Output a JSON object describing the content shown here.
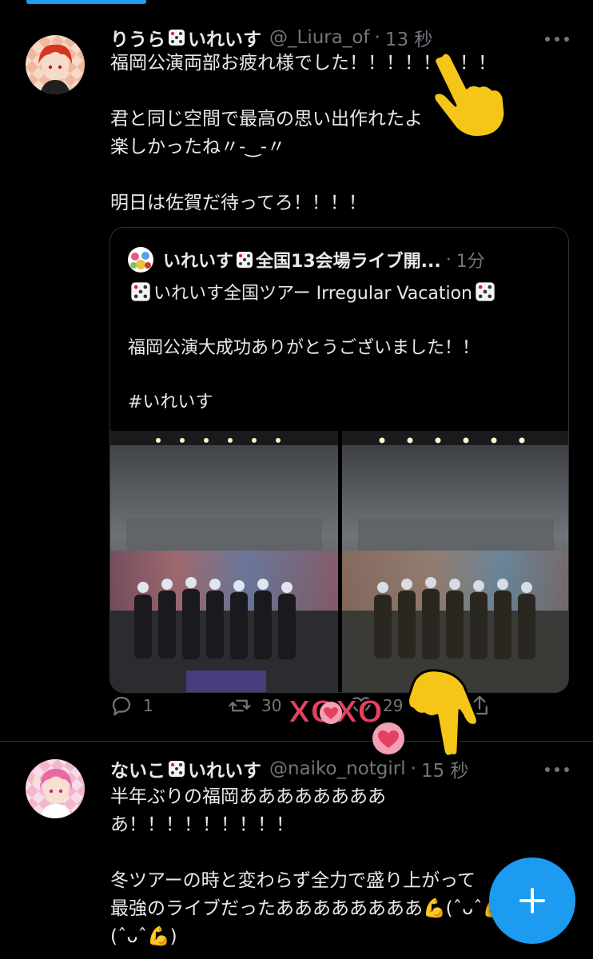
{
  "tweets": [
    {
      "display_name_a": "りうら",
      "display_name_b": "いれいす",
      "handle": "@_Liura_of",
      "separator": "·",
      "time": "13 秒",
      "text": "福岡公演両部お疲れ様でした！！！！！！！！\n\n君と同じ空間で最高の思い出作れたよ\n楽しかったね〃-‿-〃\n\n明日は佐賀だ待ってろ！！！！",
      "quote": {
        "display_name_a": "いれいす",
        "display_name_b": "全国13会場ライブ開...",
        "separator": "·",
        "time": "1分",
        "title": "いれいす全国ツアー Irregular Vacation",
        "text": "福岡公演大成功ありがとうございました！！\n\n#いれいす"
      },
      "actions": {
        "reply": "1",
        "retweet": "30",
        "like": "29"
      }
    },
    {
      "display_name_a": "ないこ",
      "display_name_b": "いれいす",
      "handle": "@naiko_notgirl",
      "separator": "·",
      "time": "15 秒",
      "text": "半年ぶりの福岡ああああああああ\nあ！！！！！！！！！\n\n冬ツアーの時と変わらず全力で盛り上がって\n最強のライブだったああああああああ💪(ˆᴗˆ💪\n(ˆᴗˆ💪)"
    }
  ],
  "colors": {
    "accent": "#1d9bf0",
    "background": "#000000",
    "secondary_text": "#71767b",
    "sticker_pointer": "#f5c518",
    "sticker_xoxo": "#e3415f"
  },
  "stickers": {
    "xoxo": "XOXO"
  }
}
